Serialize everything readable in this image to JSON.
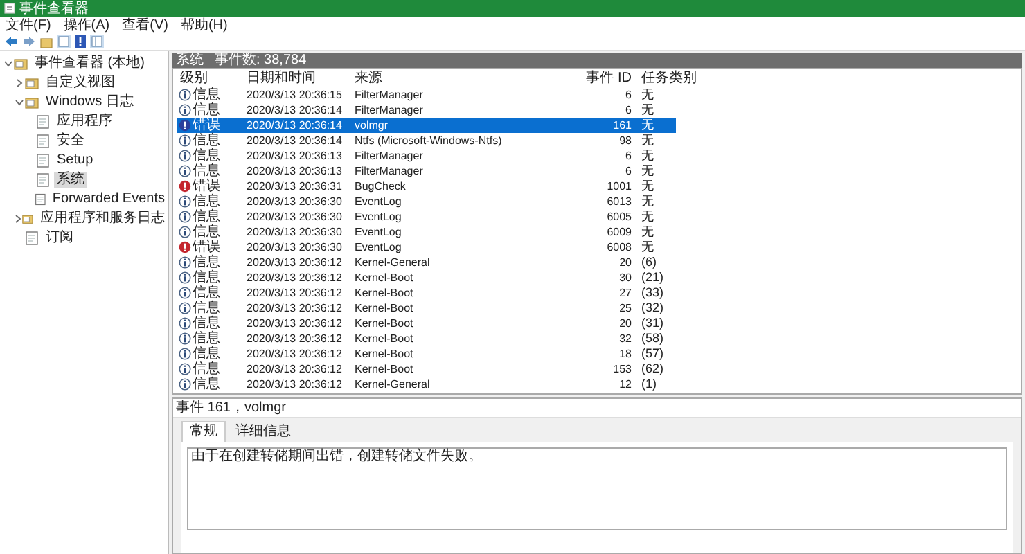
{
  "window": {
    "title": "事件查看器"
  },
  "menu": [
    "文件(F)",
    "操作(A)",
    "查看(V)",
    "帮助(H)"
  ],
  "tree": [
    {
      "label": "事件查看器 (本地)",
      "expanded": true,
      "selected": false,
      "children": [
        {
          "label": "自定义视图",
          "expanded": false,
          "selected": false
        },
        {
          "label": "Windows 日志",
          "expanded": true,
          "selected": false,
          "children": [
            {
              "label": "应用程序",
              "selected": false
            },
            {
              "label": "安全",
              "selected": false
            },
            {
              "label": "Setup",
              "selected": false
            },
            {
              "label": "系统",
              "selected": true
            },
            {
              "label": "Forwarded Events",
              "selected": false
            }
          ]
        },
        {
          "label": "应用程序和服务日志",
          "expanded": false,
          "selected": false
        },
        {
          "label": "订阅",
          "selected": false
        }
      ]
    }
  ],
  "log_header": {
    "name": "系统",
    "count": "事件数: 38,784"
  },
  "table": {
    "columns": [
      "级别",
      "日期和时间",
      "来源",
      "事件 ID",
      "任务类别"
    ],
    "rows": [
      {
        "kind": "info",
        "level": "信息",
        "date": "2020/3/13 20:36:15",
        "source": "FilterManager",
        "id": "6",
        "task": "无",
        "selected": false
      },
      {
        "kind": "info",
        "level": "信息",
        "date": "2020/3/13 20:36:14",
        "source": "FilterManager",
        "id": "6",
        "task": "无",
        "selected": false
      },
      {
        "kind": "error",
        "level": "错误",
        "date": "2020/3/13 20:36:14",
        "source": "volmgr",
        "id": "161",
        "task": "无",
        "selected": true
      },
      {
        "kind": "info",
        "level": "信息",
        "date": "2020/3/13 20:36:14",
        "source": "Ntfs (Microsoft-Windows-Ntfs)",
        "id": "98",
        "task": "无",
        "selected": false
      },
      {
        "kind": "info",
        "level": "信息",
        "date": "2020/3/13 20:36:13",
        "source": "FilterManager",
        "id": "6",
        "task": "无",
        "selected": false
      },
      {
        "kind": "info",
        "level": "信息",
        "date": "2020/3/13 20:36:13",
        "source": "FilterManager",
        "id": "6",
        "task": "无",
        "selected": false
      },
      {
        "kind": "error",
        "level": "错误",
        "date": "2020/3/13 20:36:31",
        "source": "BugCheck",
        "id": "1001",
        "task": "无",
        "selected": false
      },
      {
        "kind": "info",
        "level": "信息",
        "date": "2020/3/13 20:36:30",
        "source": "EventLog",
        "id": "6013",
        "task": "无",
        "selected": false
      },
      {
        "kind": "info",
        "level": "信息",
        "date": "2020/3/13 20:36:30",
        "source": "EventLog",
        "id": "6005",
        "task": "无",
        "selected": false
      },
      {
        "kind": "info",
        "level": "信息",
        "date": "2020/3/13 20:36:30",
        "source": "EventLog",
        "id": "6009",
        "task": "无",
        "selected": false
      },
      {
        "kind": "error",
        "level": "错误",
        "date": "2020/3/13 20:36:30",
        "source": "EventLog",
        "id": "6008",
        "task": "无",
        "selected": false
      },
      {
        "kind": "info",
        "level": "信息",
        "date": "2020/3/13 20:36:12",
        "source": "Kernel-General",
        "id": "20",
        "task": "(6)",
        "selected": false
      },
      {
        "kind": "info",
        "level": "信息",
        "date": "2020/3/13 20:36:12",
        "source": "Kernel-Boot",
        "id": "30",
        "task": "(21)",
        "selected": false
      },
      {
        "kind": "info",
        "level": "信息",
        "date": "2020/3/13 20:36:12",
        "source": "Kernel-Boot",
        "id": "27",
        "task": "(33)",
        "selected": false
      },
      {
        "kind": "info",
        "level": "信息",
        "date": "2020/3/13 20:36:12",
        "source": "Kernel-Boot",
        "id": "25",
        "task": "(32)",
        "selected": false
      },
      {
        "kind": "info",
        "level": "信息",
        "date": "2020/3/13 20:36:12",
        "source": "Kernel-Boot",
        "id": "20",
        "task": "(31)",
        "selected": false
      },
      {
        "kind": "info",
        "level": "信息",
        "date": "2020/3/13 20:36:12",
        "source": "Kernel-Boot",
        "id": "32",
        "task": "(58)",
        "selected": false
      },
      {
        "kind": "info",
        "level": "信息",
        "date": "2020/3/13 20:36:12",
        "source": "Kernel-Boot",
        "id": "18",
        "task": "(57)",
        "selected": false
      },
      {
        "kind": "info",
        "level": "信息",
        "date": "2020/3/13 20:36:12",
        "source": "Kernel-Boot",
        "id": "153",
        "task": "(62)",
        "selected": false
      },
      {
        "kind": "info",
        "level": "信息",
        "date": "2020/3/13 20:36:12",
        "source": "Kernel-General",
        "id": "12",
        "task": "(1)",
        "selected": false
      }
    ]
  },
  "detail": {
    "title": "事件 161，volmgr",
    "tabs": [
      {
        "label": "常规",
        "selected": true
      },
      {
        "label": "详细信息",
        "selected": false
      }
    ],
    "message": "由于在创建转储期间出错，创建转储文件失败。"
  }
}
